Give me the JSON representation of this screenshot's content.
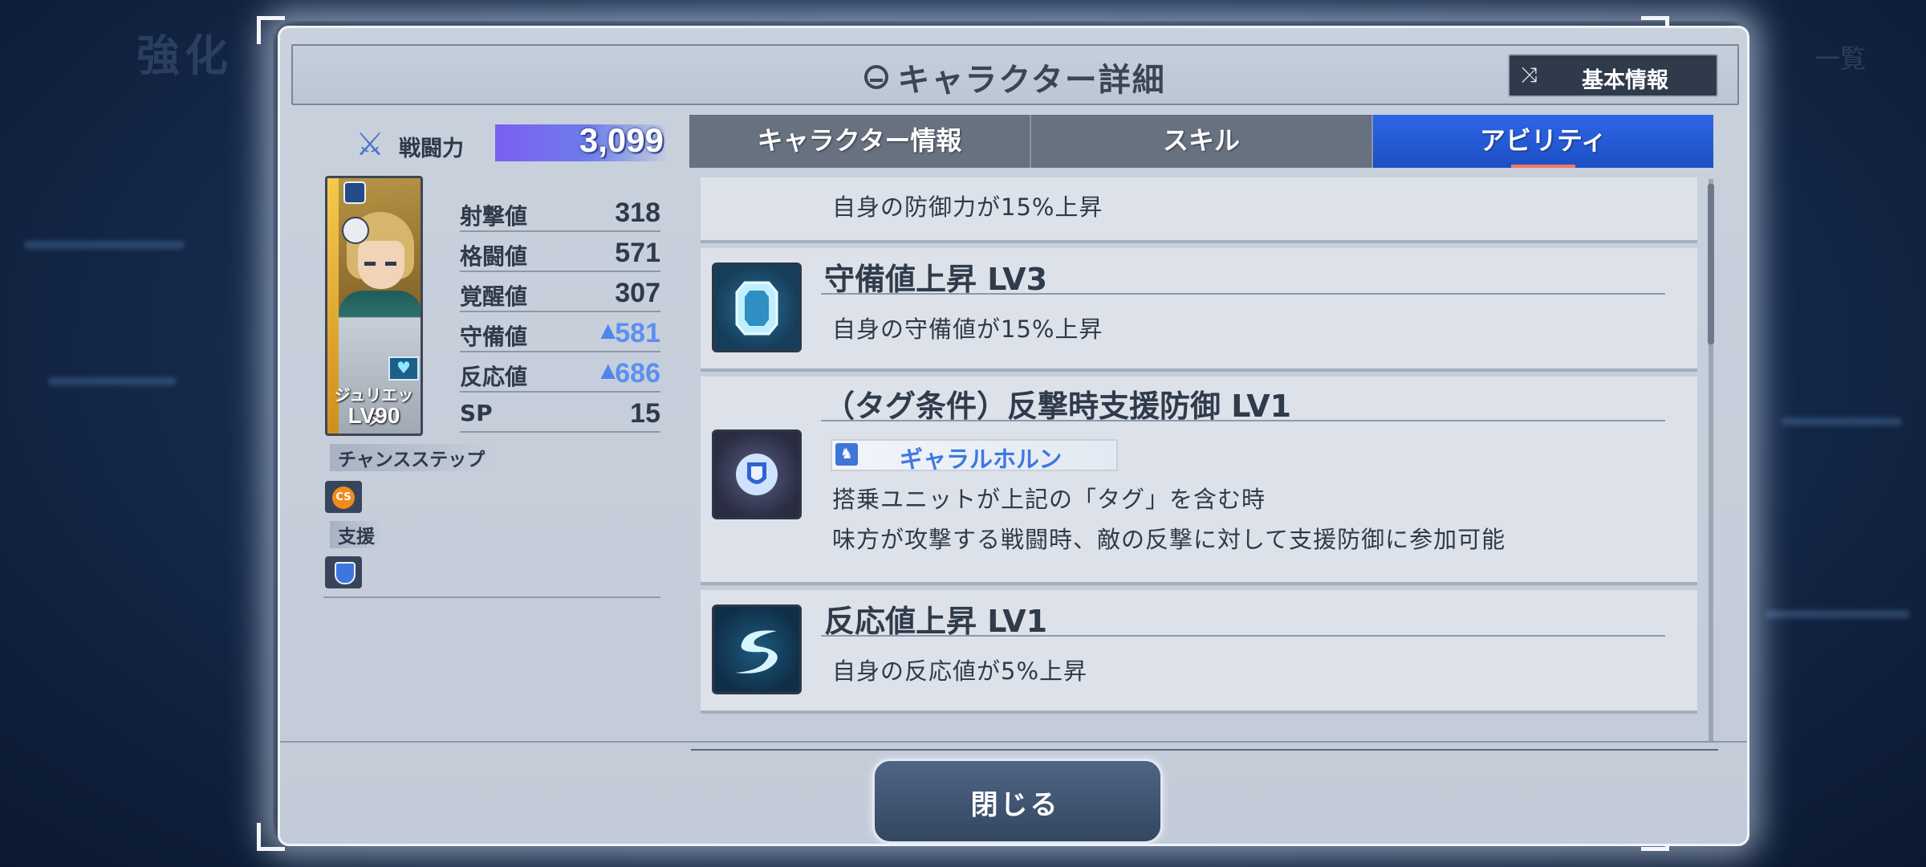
{
  "background": {
    "ghost_title": "強化",
    "ghost_right": "一覧"
  },
  "header": {
    "title": "キャラクター詳細",
    "basic_info_button": "基本情報",
    "title_icon": "helmet-icon",
    "shuffle_icon": "shuffle-icon"
  },
  "character": {
    "power_label": "戦闘力",
    "power_value": "3,099",
    "name": "ジュリエッタ",
    "level": "LV90",
    "stats": [
      {
        "label": "射撃値",
        "value": "318",
        "boosted": false
      },
      {
        "label": "格闘値",
        "value": "571",
        "boosted": false
      },
      {
        "label": "覚醒値",
        "value": "307",
        "boosted": false
      },
      {
        "label": "守備値",
        "value": "581",
        "boosted": true
      },
      {
        "label": "反応値",
        "value": "686",
        "boosted": true
      },
      {
        "label": "SP",
        "value": "15",
        "boosted": false
      }
    ],
    "chance_step_label": "チャンスステップ",
    "chance_step_icon_text": "CS",
    "support_label": "支援"
  },
  "tabs": [
    {
      "label": "キャラクター情報",
      "active": false
    },
    {
      "label": "スキル",
      "active": false
    },
    {
      "label": "アビリティ",
      "active": true
    }
  ],
  "abilities": [
    {
      "title": "",
      "desc": [
        "自身の防御力が15%上昇"
      ],
      "icon": "shield-icon"
    },
    {
      "title": "守備値上昇 LV3",
      "desc": [
        "自身の守備値が15%上昇"
      ],
      "icon": "defense-plate-icon"
    },
    {
      "title": "（タグ条件）反撃時支援防御 LV1",
      "tag": "ギャラルホルン",
      "desc": [
        "搭乗ユニットが上記の「タグ」を含む時",
        "味方が攻撃する戦闘時、敵の反撃に対して支援防御に参加可能"
      ],
      "icon": "support-shield-icon"
    },
    {
      "title": "反応値上昇 LV1",
      "desc": [
        "自身の反応値が5%上昇"
      ],
      "icon": "reaction-swoosh-icon"
    }
  ],
  "footer": {
    "close_button": "閉じる"
  },
  "colors": {
    "active_tab": "#2c66e6",
    "boosted_stat": "#5b8ff0",
    "tag_text": "#3e78e0"
  }
}
